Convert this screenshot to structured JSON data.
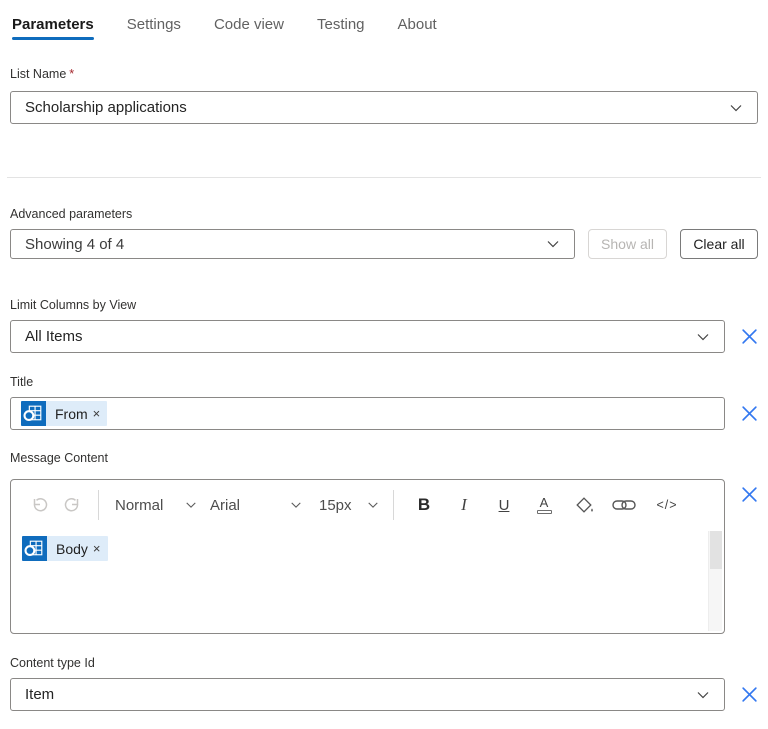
{
  "colors": {
    "accent": "#0f6cbd",
    "remove_x": "#3378f0",
    "chip_bg": "#deecf9",
    "chip_icon_bg": "#0f6cbd",
    "required": "#a4262c"
  },
  "tabs": [
    {
      "label": "Parameters",
      "active": true
    },
    {
      "label": "Settings",
      "active": false
    },
    {
      "label": "Code view",
      "active": false
    },
    {
      "label": "Testing",
      "active": false
    },
    {
      "label": "About",
      "active": false
    }
  ],
  "list_name": {
    "label": "List Name",
    "required_marker": "*",
    "value": "Scholarship applications"
  },
  "advanced": {
    "label": "Advanced parameters",
    "value": "Showing 4 of 4",
    "show_all_label": "Show all",
    "clear_all_label": "Clear all"
  },
  "limit_columns": {
    "label": "Limit Columns by View",
    "value": "All Items"
  },
  "title_field": {
    "label": "Title",
    "token_label": "From",
    "token_remove": "×"
  },
  "message_content": {
    "label": "Message Content",
    "token_label": "Body",
    "token_remove": "×",
    "toolbar": {
      "paragraph_format": "Normal",
      "font_family": "Arial",
      "font_size": "15px",
      "bold_label": "B",
      "italic_label": "I",
      "underline_label": "U",
      "font_color_label": "A",
      "code_label": "</>"
    }
  },
  "content_type": {
    "label": "Content type Id",
    "value": "Item"
  }
}
